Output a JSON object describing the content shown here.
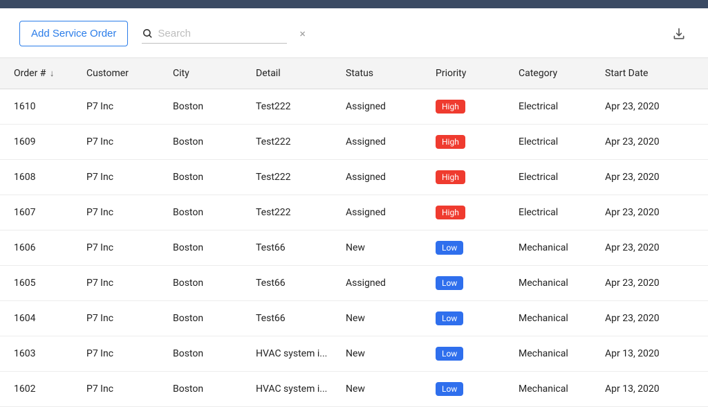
{
  "toolbar": {
    "add_label": "Add Service Order",
    "search_placeholder": "Search"
  },
  "columns": {
    "order": "Order #",
    "customer": "Customer",
    "city": "City",
    "detail": "Detail",
    "status": "Status",
    "priority": "Priority",
    "category": "Category",
    "start_date": "Start Date"
  },
  "rows": [
    {
      "order": "1610",
      "customer": "P7 Inc",
      "city": "Boston",
      "detail": "Test222",
      "status": "Assigned",
      "priority": "High",
      "category": "Electrical",
      "start_date": "Apr 23, 2020"
    },
    {
      "order": "1609",
      "customer": "P7 Inc",
      "city": "Boston",
      "detail": "Test222",
      "status": "Assigned",
      "priority": "High",
      "category": "Electrical",
      "start_date": "Apr 23, 2020"
    },
    {
      "order": "1608",
      "customer": "P7 Inc",
      "city": "Boston",
      "detail": "Test222",
      "status": "Assigned",
      "priority": "High",
      "category": "Electrical",
      "start_date": "Apr 23, 2020"
    },
    {
      "order": "1607",
      "customer": "P7 Inc",
      "city": "Boston",
      "detail": "Test222",
      "status": "Assigned",
      "priority": "High",
      "category": "Electrical",
      "start_date": "Apr 23, 2020"
    },
    {
      "order": "1606",
      "customer": "P7 Inc",
      "city": "Boston",
      "detail": "Test66",
      "status": "New",
      "priority": "Low",
      "category": "Mechanical",
      "start_date": "Apr 23, 2020"
    },
    {
      "order": "1605",
      "customer": "P7 Inc",
      "city": "Boston",
      "detail": "Test66",
      "status": "Assigned",
      "priority": "Low",
      "category": "Mechanical",
      "start_date": "Apr 23, 2020"
    },
    {
      "order": "1604",
      "customer": "P7 Inc",
      "city": "Boston",
      "detail": "Test66",
      "status": "New",
      "priority": "Low",
      "category": "Mechanical",
      "start_date": "Apr 23, 2020"
    },
    {
      "order": "1603",
      "customer": "P7 Inc",
      "city": "Boston",
      "detail": "HVAC system i...",
      "status": "New",
      "priority": "Low",
      "category": "Mechanical",
      "start_date": "Apr 13, 2020"
    },
    {
      "order": "1602",
      "customer": "P7 Inc",
      "city": "Boston",
      "detail": "HVAC system i...",
      "status": "New",
      "priority": "Low",
      "category": "Mechanical",
      "start_date": "Apr 13, 2020"
    }
  ]
}
